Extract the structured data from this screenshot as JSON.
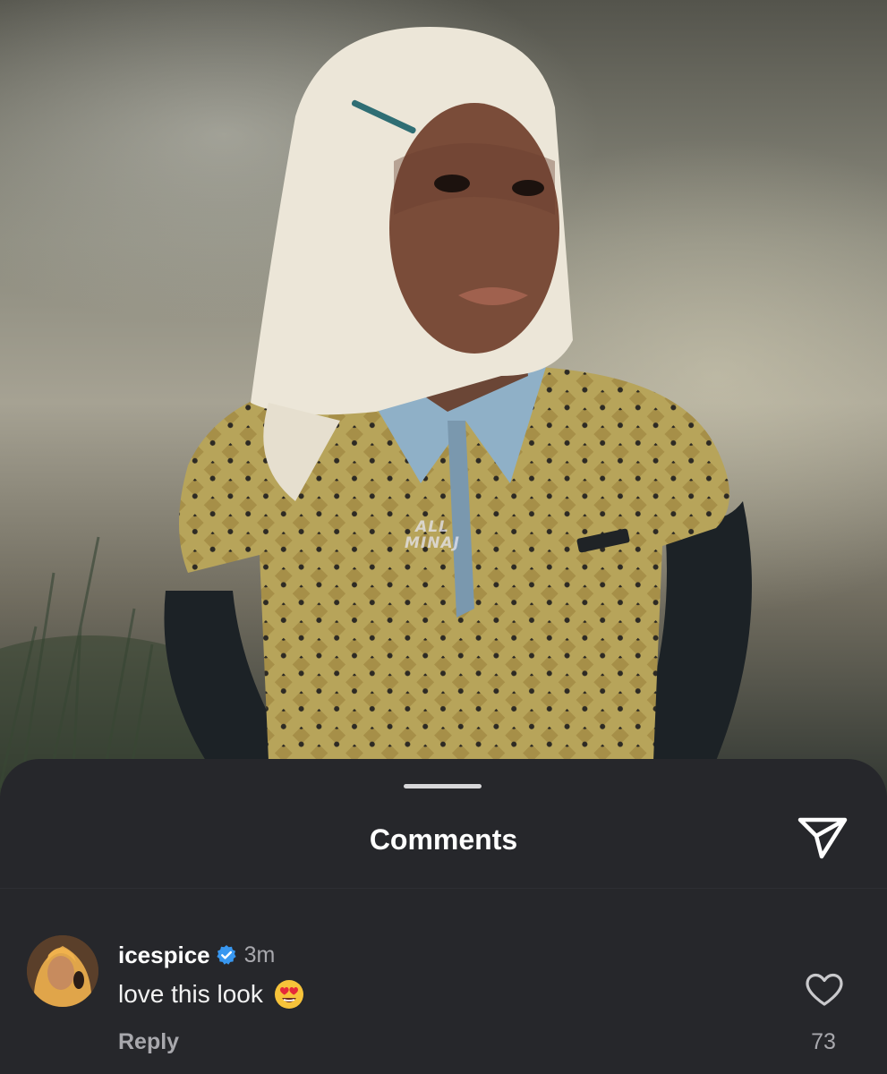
{
  "photo": {
    "watermark_line1": "ALL",
    "watermark_line2": "MINAJ",
    "icon": "portrait-photo"
  },
  "sheet": {
    "title": "Comments",
    "send_icon": "send-paper-plane-icon"
  },
  "comment": {
    "username": "icespice",
    "verified_icon": "verified-badge-icon",
    "time": "3m",
    "text": "love this look",
    "emoji_icon": "heart-eyes-emoji",
    "reply_label": "Reply",
    "like_icon": "heart-outline-icon",
    "like_count": "73"
  },
  "colors": {
    "sheet_bg": "#26272b",
    "verified_blue": "#3897f0",
    "muted_text": "#a8a8ad"
  }
}
